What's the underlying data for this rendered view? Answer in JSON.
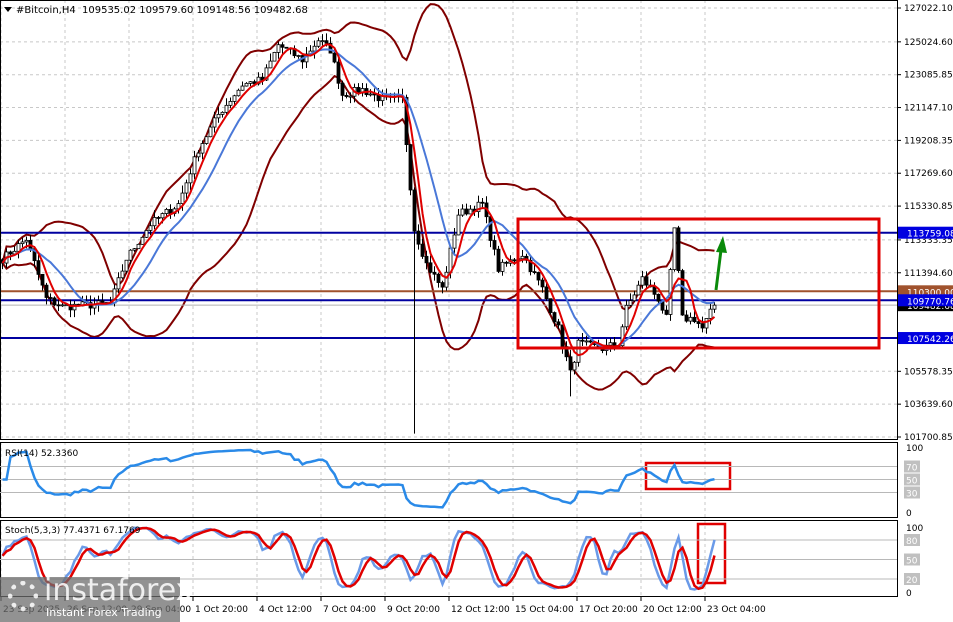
{
  "chart_data": {
    "type": "candlestick",
    "symbol": "#Bitcoin,H4",
    "header_ohlc": [
      "109535.02",
      "109579.60",
      "109148.56",
      "109482.68"
    ],
    "price_ticks": [
      "127022.10",
      "125024.60",
      "123085.85",
      "121147.10",
      "119208.35",
      "117269.60",
      "115330.85",
      "113333.35",
      "111394.60",
      "105578.35",
      "103639.60",
      "101700.85"
    ],
    "price_tick_values": [
      127022.1,
      125024.6,
      123085.85,
      121147.1,
      119208.35,
      117269.6,
      115330.85,
      113333.35,
      111394.6,
      105578.35,
      103639.6,
      101700.85
    ],
    "ylim": [
      101700.85,
      127022.1
    ],
    "time_ticks": [
      "23 Sep 2025",
      "26 Sep 12:00",
      "29 Sep 04:00",
      "1 Oct 20:00",
      "4 Oct 12:00",
      "7 Oct 04:00",
      "9 Oct 20:00",
      "12 Oct 12:00",
      "15 Oct 04:00",
      "17 Oct 20:00",
      "20 Oct 12:00",
      "23 Oct 04:00"
    ],
    "bars_per_time_tick": 16,
    "bar_count": 179,
    "close_waypoints": [
      [
        0,
        112217
      ],
      [
        6,
        113392
      ],
      [
        11,
        109867
      ],
      [
        15,
        109397
      ],
      [
        27,
        109574
      ],
      [
        31,
        112217
      ],
      [
        37,
        114273
      ],
      [
        44,
        115448
      ],
      [
        49,
        118680
      ],
      [
        54,
        120736
      ],
      [
        60,
        122499
      ],
      [
        65,
        122792
      ],
      [
        69,
        124848
      ],
      [
        75,
        123967
      ],
      [
        79,
        125142
      ],
      [
        82,
        124555
      ],
      [
        85,
        121911
      ],
      [
        90,
        122205
      ],
      [
        95,
        121617
      ],
      [
        100,
        121617
      ],
      [
        103,
        113980
      ],
      [
        106,
        111924
      ],
      [
        110,
        110454
      ],
      [
        114,
        114861
      ],
      [
        120,
        115448
      ],
      [
        124,
        111630
      ],
      [
        130,
        112511
      ],
      [
        135,
        110454
      ],
      [
        139,
        108105
      ],
      [
        142,
        105461
      ],
      [
        144,
        107223
      ],
      [
        150,
        106929
      ],
      [
        154,
        107223
      ],
      [
        156,
        109279
      ],
      [
        160,
        111042
      ],
      [
        164,
        109867
      ],
      [
        166,
        108692
      ],
      [
        168,
        113980
      ],
      [
        170,
        108692
      ],
      [
        173,
        108692
      ],
      [
        175,
        108105
      ],
      [
        178,
        109482
      ]
    ],
    "horizontal_levels": [
      {
        "label": "113759.08",
        "value": 113759.08,
        "color": "#0000a0"
      },
      {
        "label": "110300.00",
        "value": 110300.0,
        "color": "#a0522d"
      },
      {
        "label": "109770.76",
        "value": 109770.76,
        "color": "#0000a0"
      },
      {
        "label": "107542.26",
        "value": 107542.26,
        "color": "#0000a0"
      }
    ],
    "current_price": {
      "label": "109482.68",
      "value": 109482.68
    },
    "indicators": {
      "bollinger": {
        "period": 20,
        "deviation": 2,
        "color": "#800000"
      },
      "ma_fast": {
        "period": 5,
        "color": "#e00000"
      },
      "ma_slow": {
        "period": 12,
        "color": "#4a78d8"
      },
      "rsi": {
        "label": "RSI(14) 52.3360",
        "period": 14,
        "levels": [
          "70",
          "50",
          "30"
        ],
        "bounds": [
          "100",
          "0"
        ],
        "color": "#2a8ae8"
      },
      "stoch": {
        "label": "Stoch(5,3,3) 77.4371 67.1769",
        "k": 5,
        "d": 3,
        "slowing": 3,
        "levels": [
          "80",
          "50",
          "20"
        ],
        "bounds": [
          "100",
          "0"
        ],
        "k_color": "#6a9ae8",
        "d_color": "#e00000"
      }
    },
    "annotations": {
      "box_color": "#e00000",
      "arrow_color": "#0a8a0a",
      "arrow_direction": "up"
    }
  },
  "watermark": {
    "brand": "instaforex",
    "tagline": "Instant Forex Trading"
  }
}
